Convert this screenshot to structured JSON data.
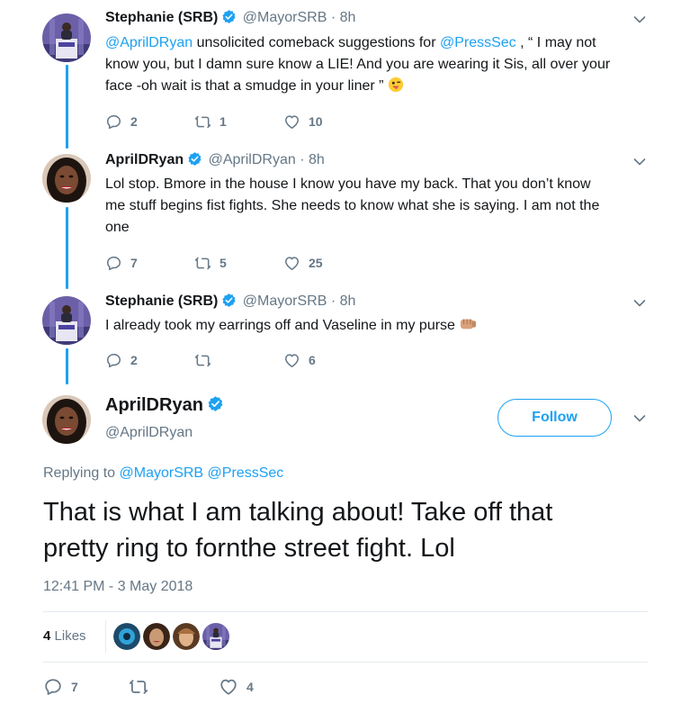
{
  "thread": [
    {
      "name": "Stephanie (SRB)",
      "handle": "@MayorSRB",
      "dot": "·",
      "time": "8h",
      "text_line1_mention": "@AprilDRyan",
      "text_line1_rest": " unsolicited comeback suggestions for ",
      "text_line1_mention2": "@PressSec",
      "text_line1_tail": " , “ I may not",
      "text_line2": "know you, but I damn sure know a LIE!  And you are wearing it Sis, all over your",
      "text_line3": "face -oh wait is that a smudge in your liner ”",
      "replies": "2",
      "retweets": "1",
      "likes": "10"
    },
    {
      "name": "AprilDRyan",
      "handle": "@AprilDRyan",
      "dot": "·",
      "time": "8h",
      "text_line1": "Lol stop. Bmore in the house I know you have my back.  That you don’t know",
      "text_line2": "me stuff begins fist fights. She needs to know what she is saying.   I am not the",
      "text_line3": "one",
      "replies": "7",
      "retweets": "5",
      "likes": "25"
    },
    {
      "name": "Stephanie (SRB)",
      "handle": "@MayorSRB",
      "dot": "·",
      "time": "8h",
      "text_line1": "I already took my earrings off and Vaseline in my purse",
      "replies": "2",
      "retweets": "",
      "likes": "6"
    }
  ],
  "main_tweet": {
    "name": "AprilDRyan",
    "handle": "@AprilDRyan",
    "follow_label": "Follow",
    "replying_prefix": "Replying to ",
    "replying_to1": "@MayorSRB",
    "replying_to2": "@PressSec",
    "text_line1": "That is what I am talking about!  Take off that",
    "text_line2": "pretty ring to fornthe street fight. Lol",
    "timestamp": "12:41 PM - 3 May 2018",
    "likes_count": "4",
    "likes_label": "Likes",
    "replies": "7",
    "retweets": "",
    "likes": "4"
  },
  "colors": {
    "accent": "#1da1f2",
    "muted": "#657786",
    "text": "#14171a",
    "divider": "#e6ecf0"
  },
  "icons": {
    "reply": "reply-icon",
    "retweet": "retweet-icon",
    "like": "heart-icon",
    "more": "chevron-down-icon",
    "verified": "verified-badge-icon"
  }
}
